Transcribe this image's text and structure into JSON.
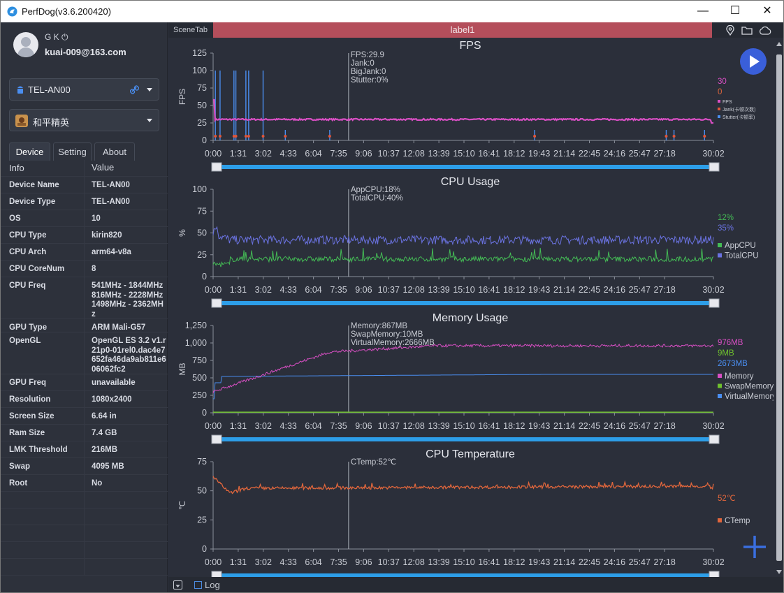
{
  "window": {
    "title": "PerfDog(v3.6.200420)",
    "minimize": "—",
    "maximize": "☐",
    "close": "✕"
  },
  "user": {
    "name": "G K",
    "power_icon": "⏻",
    "email": "kuai-009@163.com"
  },
  "device_select": {
    "value": "TEL-AN00",
    "icon": "android-icon"
  },
  "app_select": {
    "value": "和平精英",
    "icon": "game-app-icon"
  },
  "tabs": [
    {
      "label": "Device",
      "active": true
    },
    {
      "label": "Setting",
      "active": false
    },
    {
      "label": "About",
      "active": false
    }
  ],
  "info_table": {
    "headers": [
      "Info",
      "Value"
    ],
    "rows": [
      {
        "key": "Device Name",
        "value": "TEL-AN00"
      },
      {
        "key": "Device Type",
        "value": "TEL-AN00"
      },
      {
        "key": "OS",
        "value": "10"
      },
      {
        "key": "CPU Type",
        "value": "kirin820"
      },
      {
        "key": "CPU Arch",
        "value": "arm64-v8a"
      },
      {
        "key": "CPU CoreNum",
        "value": "8"
      },
      {
        "key": "CPU Freq",
        "value": "541MHz - 1844MHz 816MHz - 2228MHz 1498MHz - 2362MHz"
      },
      {
        "key": "GPU Type",
        "value": "ARM Mali-G57"
      },
      {
        "key": "OpenGL",
        "value": "OpenGL ES 3.2 v1.r21p0-01rel0.dac4e7652fa46da9ab811e606062fc2"
      },
      {
        "key": "GPU Freq",
        "value": "unavailable"
      },
      {
        "key": "Resolution",
        "value": "1080x2400"
      },
      {
        "key": "Screen Size",
        "value": "6.64 in"
      },
      {
        "key": "Ram Size",
        "value": "7.4 GB"
      },
      {
        "key": "LMK Threshold",
        "value": "216MB"
      },
      {
        "key": "Swap",
        "value": "4095 MB"
      },
      {
        "key": "Root",
        "value": "No"
      }
    ]
  },
  "scene_bar": {
    "scene_tab": "SceneTab",
    "label": "label1",
    "icons": [
      "location-icon",
      "folder-icon",
      "cloud-icon"
    ]
  },
  "bottom_bar": {
    "log_label": "Log"
  },
  "x_tick_labels": [
    "0:00",
    "1:31",
    "3:02",
    "4:33",
    "6:04",
    "7:35",
    "9:06",
    "10:37",
    "12:08",
    "13:39",
    "15:10",
    "16:41",
    "18:12",
    "19:43",
    "21:14",
    "22:45",
    "24:16",
    "25:47",
    "27:18",
    "30:02"
  ],
  "colors": {
    "fps": "#d94fc4",
    "jank": "#e0563a",
    "stutter": "#4a8ef0",
    "app_cpu": "#44bb55",
    "total_cpu": "#6a72e0",
    "memory": "#d94fc4",
    "swap": "#6fc12e",
    "virtual": "#4a8ef0",
    "ctemp": "#e0663c",
    "accent_blue": "#2d9ee8",
    "label_bar": "#b44e5b"
  },
  "chart_data": [
    {
      "type": "line",
      "title": "FPS",
      "ylabel": "FPS",
      "ylim": [
        0,
        125
      ],
      "yticks": [
        0,
        25,
        50,
        75,
        100,
        125
      ],
      "cursor_time": "8:08",
      "tooltip": [
        "FPS:29.9",
        "Jank:0",
        "BigJank:0",
        "Stutter:0%"
      ],
      "current_values": [
        {
          "text": "30",
          "color": "#d94fc4"
        },
        {
          "text": "0",
          "color": "#e0663c"
        }
      ],
      "legend": [
        {
          "name": "FPS",
          "color": "#d94fc4"
        },
        {
          "name": "Jank(卡顿次数)",
          "color": "#e0563a"
        },
        {
          "name": "Stutter(卡顿率)",
          "color": "#4a8ef0"
        }
      ],
      "series": [
        {
          "name": "FPS",
          "values_min_sec": [
            [
              0,
              58
            ],
            [
              5,
              30
            ],
            [
              60,
              30
            ],
            [
              180,
              30
            ],
            [
              600,
              30
            ],
            [
              1200,
              30
            ],
            [
              1800,
              30
            ],
            [
              1802,
              25
            ]
          ]
        }
      ]
    },
    {
      "type": "line",
      "title": "CPU Usage",
      "ylabel": "%",
      "ylim": [
        0,
        100
      ],
      "yticks": [
        0,
        25,
        50,
        75,
        100
      ],
      "tooltip": [
        "AppCPU:18%",
        "TotalCPU:40%"
      ],
      "current_values": [
        {
          "text": "12%",
          "color": "#44bb55"
        },
        {
          "text": "35%",
          "color": "#6a72e0"
        }
      ],
      "legend": [
        {
          "name": "AppCPU",
          "color": "#44bb55"
        },
        {
          "name": "TotalCPU",
          "color": "#6a72e0"
        }
      ],
      "series": [
        {
          "name": "AppCPU",
          "approx_level": 20
        },
        {
          "name": "TotalCPU",
          "approx_level": 42
        }
      ]
    },
    {
      "type": "line",
      "title": "Memory Usage",
      "ylabel": "MB",
      "ylim": [
        0,
        1250
      ],
      "yticks": [
        0,
        250,
        500,
        750,
        "1,000",
        "1,250"
      ],
      "tooltip": [
        "Memory:867MB",
        "SwapMemory:10MB",
        "VirtualMemory:2666MB"
      ],
      "current_values": [
        {
          "text": "976MB",
          "color": "#d94fc4"
        },
        {
          "text": "9MB",
          "color": "#6fc12e"
        },
        {
          "text": "2673MB",
          "color": "#4a8ef0"
        }
      ],
      "legend": [
        {
          "name": "Memory",
          "color": "#d94fc4"
        },
        {
          "name": "SwapMemory",
          "color": "#6fc12e"
        },
        {
          "name": "VirtualMemory",
          "color": "#4a8ef0"
        }
      ],
      "series": [
        {
          "name": "Memory",
          "approx_level": 960
        },
        {
          "name": "SwapMemory",
          "approx_level": 9
        },
        {
          "name": "VirtualMemory",
          "approx_level": 540
        }
      ]
    },
    {
      "type": "line",
      "title": "CPU Temperature",
      "ylabel": "℃",
      "ylim": [
        0,
        75
      ],
      "yticks": [
        0,
        25,
        50,
        75
      ],
      "tooltip": [
        "CTemp:52℃"
      ],
      "current_values": [
        {
          "text": "52℃",
          "color": "#e0663c"
        }
      ],
      "legend": [
        {
          "name": "CTemp",
          "color": "#e0663c"
        }
      ],
      "series": [
        {
          "name": "CTemp",
          "approx_level": 53
        }
      ]
    }
  ]
}
